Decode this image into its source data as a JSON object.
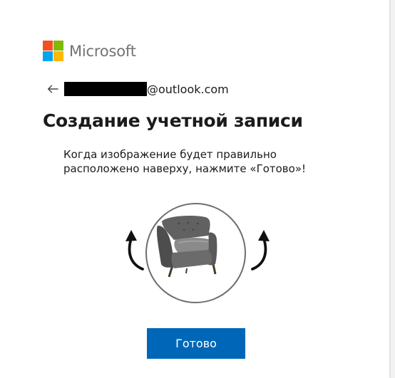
{
  "brand": {
    "name": "Microsoft",
    "logo_colors": [
      "#f25022",
      "#7fba00",
      "#00a4ef",
      "#ffb900"
    ]
  },
  "identity": {
    "back_icon": "arrow-left-icon",
    "email_domain": "@outlook.com"
  },
  "page": {
    "title": "Создание учетной записи",
    "instruction": "Когда изображение будет правильно расположено наверху, нажмите «Готово»!"
  },
  "puzzle": {
    "image_subject": "armchair",
    "rotate_left_icon": "rotate-left-icon",
    "rotate_right_icon": "rotate-right-icon"
  },
  "actions": {
    "done_label": "Готово",
    "accent_color": "#0067b8"
  }
}
